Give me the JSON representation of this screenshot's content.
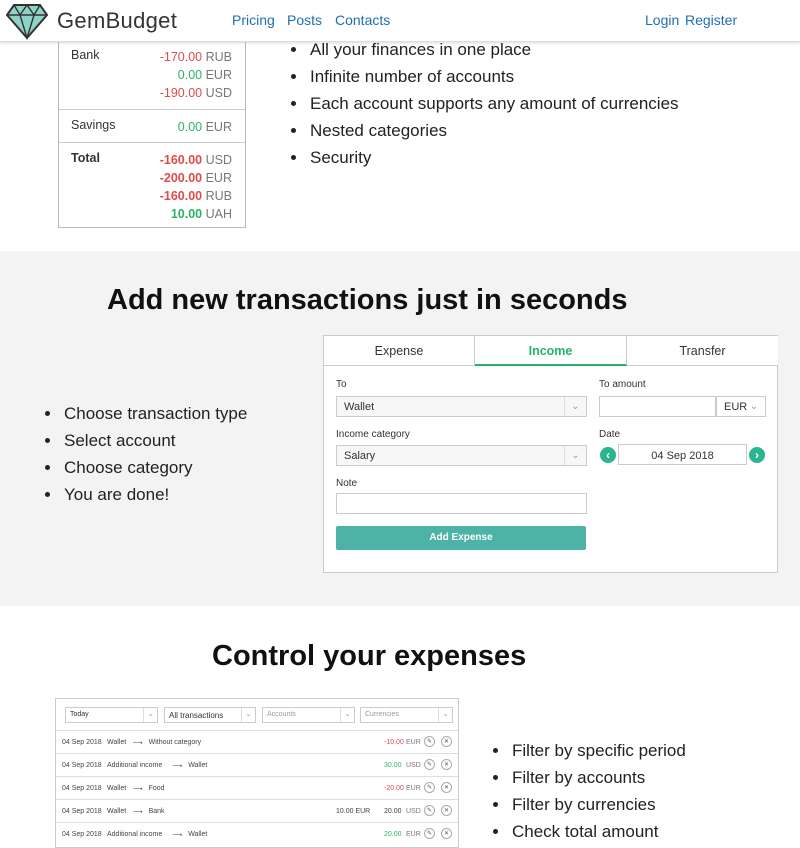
{
  "nav": {
    "brand": "GemBudget",
    "links": [
      "Pricing",
      "Posts",
      "Contacts"
    ],
    "login": "Login",
    "register": "Register"
  },
  "accounts": {
    "bank": {
      "name": "Bank",
      "values": [
        {
          "amount": "-170.00",
          "currency": "RUB",
          "sign": "neg"
        },
        {
          "amount": "0.00",
          "currency": "EUR",
          "sign": "pos"
        },
        {
          "amount": "-190.00",
          "currency": "USD",
          "sign": "neg"
        }
      ]
    },
    "savings": {
      "name": "Savings",
      "values": [
        {
          "amount": "0.00",
          "currency": "EUR",
          "sign": "pos"
        }
      ]
    },
    "total": {
      "name": "Total",
      "values": [
        {
          "amount": "-160.00",
          "currency": "USD",
          "sign": "neg"
        },
        {
          "amount": "-200.00",
          "currency": "EUR",
          "sign": "neg"
        },
        {
          "amount": "-160.00",
          "currency": "RUB",
          "sign": "neg"
        },
        {
          "amount": "10.00",
          "currency": "UAH",
          "sign": "pos"
        }
      ]
    }
  },
  "features1": [
    "All your finances in one place",
    "Infinite number of accounts",
    "Each account supports any amount of currencies",
    "Nested categories",
    "Security"
  ],
  "section2": {
    "title": "Add new transactions just in seconds",
    "steps": [
      "Choose transaction type",
      "Select account",
      "Choose category",
      "You are done!"
    ],
    "tabs": [
      "Expense",
      "Income",
      "Transfer"
    ],
    "form": {
      "to_label": "To",
      "to_value": "Wallet",
      "to_amount_label": "To amount",
      "currency": "EUR",
      "category_label": "Income category",
      "category_value": "Salary",
      "date_label": "Date",
      "date_value": "04 Sep 2018",
      "note_label": "Note",
      "submit": "Add Expense"
    }
  },
  "section3": {
    "title": "Control your expenses",
    "filters": [
      "Today",
      "All transactions",
      "Accounts",
      "Currencies"
    ],
    "rows": [
      {
        "date": "04 Sep 2018",
        "from": "Wallet",
        "to": "Without category",
        "amount": "-10.00",
        "currency": "EUR",
        "sign": "neg",
        "extra": ""
      },
      {
        "date": "04 Sep 2018",
        "from": "Additional income",
        "to": "Wallet",
        "amount": "30.00",
        "currency": "USD",
        "sign": "pos",
        "extra": ""
      },
      {
        "date": "04 Sep 2018",
        "from": "Wallet",
        "to": "Food",
        "amount": "-20.00",
        "currency": "EUR",
        "sign": "neg",
        "extra": ""
      },
      {
        "date": "04 Sep 2018",
        "from": "Wallet",
        "to": "Bank",
        "amount": "20.00",
        "currency": "USD",
        "sign": "plain",
        "extra": "10.00 EUR"
      },
      {
        "date": "04 Sep 2018",
        "from": "Additional income",
        "to": "Wallet",
        "amount": "20.00",
        "currency": "EUR",
        "sign": "pos",
        "extra": ""
      }
    ],
    "features": [
      "Filter by specific period",
      "Filter by accounts",
      "Filter by currencies",
      "Check total amount"
    ]
  },
  "colors": {
    "link": "#1f6fb2",
    "accent": "#25b36b",
    "negative": "#e04a4a",
    "button": "#4db3a6"
  }
}
